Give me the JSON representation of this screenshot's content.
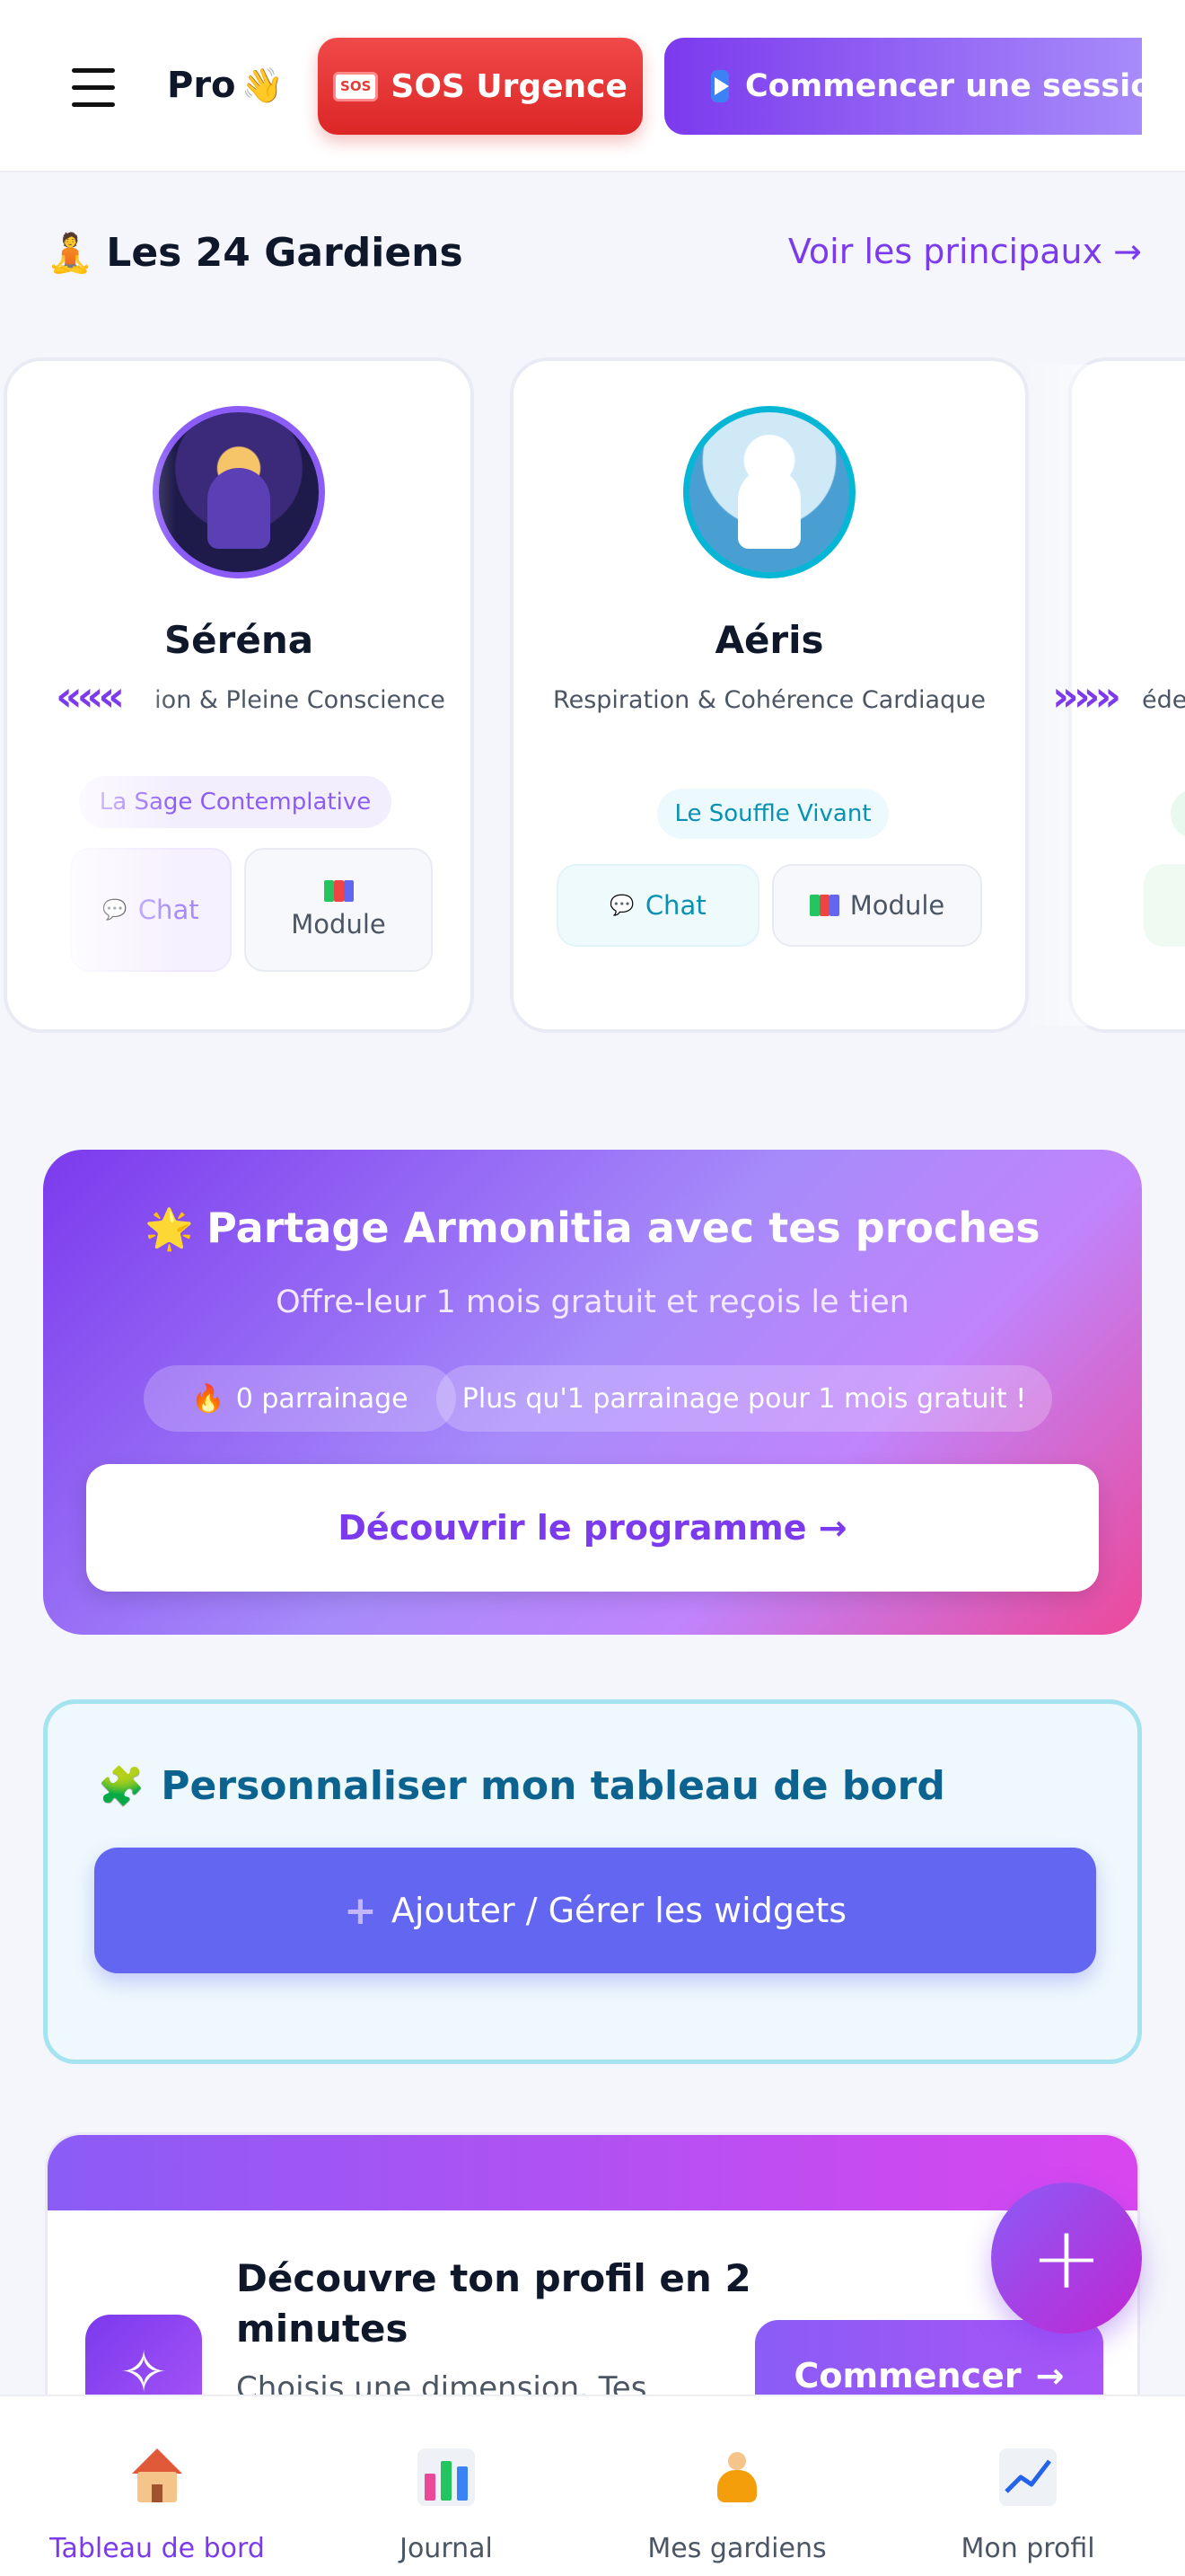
{
  "header": {
    "brand": "Pro",
    "brand_emoji": "👋",
    "sos_tag": "SOS",
    "sos_label": "SOS Urgence",
    "session_label": "Commencer une session"
  },
  "guardians": {
    "icon": "🧘",
    "title": "Les 24 Gardiens",
    "see_main_link": "Voir les principaux →",
    "prev_arrows": "«««",
    "next_arrows": "»»»",
    "cards": [
      {
        "name": "Séréna",
        "description": "ion & Pleine Conscience",
        "tag": "La Sage Contemplative",
        "chat_label": "Chat",
        "module_label": "Module",
        "accent": "#8b5cf6"
      },
      {
        "name": "Aéris",
        "description": "Respiration & Cohérence Cardiaque",
        "tag": "Le Souffle Vivant",
        "chat_label": "Chat",
        "module_label": "Module",
        "accent": "#06b6d4"
      },
      {
        "description": "édec"
      }
    ]
  },
  "referral": {
    "icon": "🌟",
    "title": "Partage Armonitia avec tes proches",
    "subtitle": "Offre-leur 1 mois gratuit et reçois le tien",
    "count_icon": "🔥",
    "count_label": "0 parrainage",
    "hint": "Plus qu'1 parrainage pour 1 mois gratuit !",
    "cta": "Découvrir le programme →"
  },
  "customize": {
    "icon": "🧩",
    "title": "Personnaliser mon tableau de bord",
    "button_icon": "+",
    "button_label": "Ajouter / Gérer les widgets"
  },
  "profile_discovery": {
    "icon": "✧",
    "title": "Découvre ton profil en 2 minutes",
    "subtitle": "Choisis une dimension. Tes",
    "button_label": "Commencer",
    "button_arrow": "→"
  },
  "fab": {
    "label": "+"
  },
  "bottom_nav": [
    {
      "label": "Tableau de bord",
      "active": true
    },
    {
      "label": "Journal",
      "active": false
    },
    {
      "label": "Mes gardiens",
      "active": false
    },
    {
      "label": "Mon profil",
      "active": false
    }
  ],
  "colors": {
    "primary": "#7c3aed",
    "sos": "#dc2626",
    "widget_button": "#6366f1",
    "customize_title": "#0c6390"
  }
}
